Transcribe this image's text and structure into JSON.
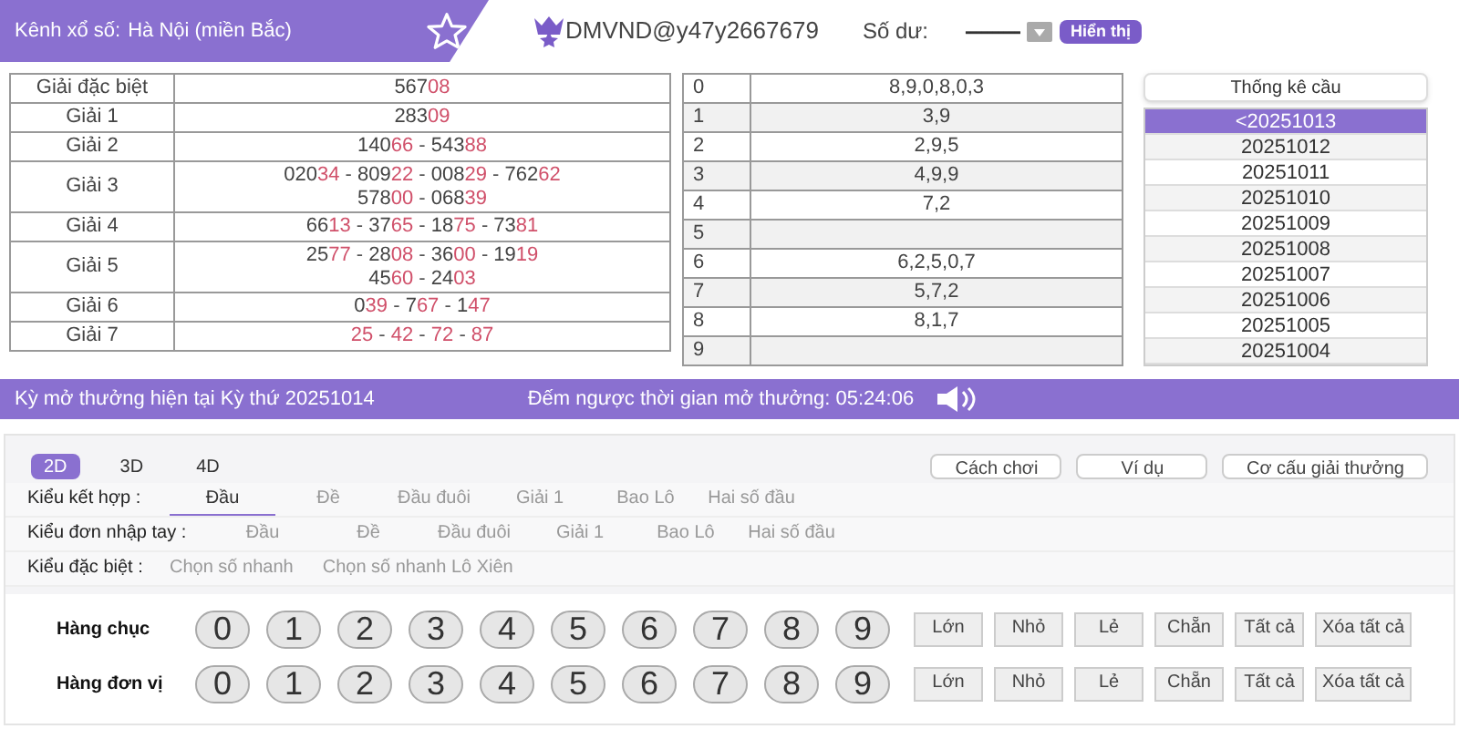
{
  "header": {
    "channel_label": "Kênh xổ số:",
    "channel": "Hà Nội (miền Bắc)",
    "username": "DMVND@y47y2667679",
    "balance_label": "Số dư:",
    "balance": "----------",
    "show_button": "Hiển thị"
  },
  "prizes": {
    "separator": " - ",
    "rows": [
      {
        "name": "Giải đặc biệt",
        "lines": [
          [
            {
              "head": "567",
              "tail": "08"
            }
          ]
        ]
      },
      {
        "name": "Giải 1",
        "lines": [
          [
            {
              "head": "283",
              "tail": "09"
            }
          ]
        ]
      },
      {
        "name": "Giải 2",
        "lines": [
          [
            {
              "head": "140",
              "tail": "66"
            },
            {
              "head": "543",
              "tail": "88"
            }
          ]
        ]
      },
      {
        "name": "Giải 3",
        "lines": [
          [
            {
              "head": "020",
              "tail": "34"
            },
            {
              "head": "809",
              "tail": "22"
            },
            {
              "head": "008",
              "tail": "29"
            },
            {
              "head": "762",
              "tail": "62"
            }
          ],
          [
            {
              "head": "578",
              "tail": "00"
            },
            {
              "head": "068",
              "tail": "39"
            }
          ]
        ]
      },
      {
        "name": "Giải 4",
        "lines": [
          [
            {
              "head": "66",
              "tail": "13"
            },
            {
              "head": "37",
              "tail": "65"
            },
            {
              "head": "18",
              "tail": "75"
            },
            {
              "head": "73",
              "tail": "81"
            }
          ]
        ]
      },
      {
        "name": "Giải 5",
        "lines": [
          [
            {
              "head": "25",
              "tail": "77"
            },
            {
              "head": "28",
              "tail": "08"
            },
            {
              "head": "36",
              "tail": "00"
            },
            {
              "head": "19",
              "tail": "19"
            }
          ],
          [
            {
              "head": "45",
              "tail": "60"
            },
            {
              "head": "24",
              "tail": "03"
            }
          ]
        ]
      },
      {
        "name": "Giải 6",
        "lines": [
          [
            {
              "head": "0",
              "tail": "39"
            },
            {
              "head": "7",
              "tail": "67"
            },
            {
              "head": "1",
              "tail": "47"
            }
          ]
        ]
      },
      {
        "name": "Giải 7",
        "lines": [
          [
            {
              "tail": "25"
            },
            {
              "tail": "42"
            },
            {
              "tail": "72"
            },
            {
              "tail": "87"
            }
          ]
        ]
      }
    ]
  },
  "head_tail": [
    {
      "digit": "0",
      "values": "8,9,0,8,0,3"
    },
    {
      "digit": "1",
      "values": "3,9"
    },
    {
      "digit": "2",
      "values": "2,9,5"
    },
    {
      "digit": "3",
      "values": "4,9,9"
    },
    {
      "digit": "4",
      "values": "7,2"
    },
    {
      "digit": "5"
    },
    {
      "digit": "6",
      "values": "6,2,5,0,7"
    },
    {
      "digit": "7",
      "values": "5,7,2"
    },
    {
      "digit": "8",
      "values": "8,1,7"
    },
    {
      "digit": "9"
    }
  ],
  "stats": {
    "button": "Thống kê cầu",
    "dates": [
      {
        "label": "<20251013",
        "selected": true
      },
      {
        "label": "20251012",
        "selected": false
      },
      {
        "label": "20251011",
        "selected": false
      },
      {
        "label": "20251010",
        "selected": false
      },
      {
        "label": "20251009",
        "selected": false
      },
      {
        "label": "20251008",
        "selected": false
      },
      {
        "label": "20251007",
        "selected": false
      },
      {
        "label": "20251006",
        "selected": false
      },
      {
        "label": "20251005",
        "selected": false
      },
      {
        "label": "20251004",
        "selected": false
      }
    ]
  },
  "draw_bar": {
    "current": "Kỳ mở thưởng hiện tại Kỳ thứ 20251014",
    "countdown": "Đếm ngược thời gian mở thưởng: 05:24:06"
  },
  "game_tabs": [
    {
      "label": "2D",
      "selected": true
    },
    {
      "label": "3D",
      "selected": false
    },
    {
      "label": "4D",
      "selected": false
    }
  ],
  "help_buttons": [
    "Cách chơi",
    "Ví dụ",
    "Cơ cấu giải thưởng"
  ],
  "bet_types": [
    {
      "label": "Kiểu kết hợp :",
      "options": [
        {
          "label": "Đầu",
          "selected": true
        },
        {
          "label": "Đề",
          "selected": false
        },
        {
          "label": "Đầu đuôi",
          "selected": false
        },
        {
          "label": "Giải 1",
          "selected": false
        },
        {
          "label": "Bao Lô",
          "selected": false
        },
        {
          "label": "Hai số đầu",
          "selected": false
        }
      ]
    },
    {
      "label": "Kiểu đơn nhập tay :",
      "options": [
        {
          "label": "Đầu",
          "selected": false
        },
        {
          "label": "Đề",
          "selected": false
        },
        {
          "label": "Đầu đuôi",
          "selected": false
        },
        {
          "label": "Giải 1",
          "selected": false
        },
        {
          "label": "Bao Lô",
          "selected": false
        },
        {
          "label": "Hai số đầu",
          "selected": false
        }
      ]
    },
    {
      "label": "Kiểu đặc biệt :",
      "options": [
        {
          "label": "Chọn số nhanh",
          "selected": false
        },
        {
          "label": "Chọn số nhanh Lô Xiên",
          "selected": false
        }
      ]
    }
  ],
  "digit_rows": [
    {
      "label": "Hàng chục",
      "digits": [
        "0",
        "1",
        "2",
        "3",
        "4",
        "5",
        "6",
        "7",
        "8",
        "9"
      ],
      "filters": [
        "Lớn",
        "Nhỏ",
        "Lẻ",
        "Chẵn",
        "Tất cả",
        "Xóa tất cả"
      ]
    },
    {
      "label": "Hàng đơn vị",
      "digits": [
        "0",
        "1",
        "2",
        "3",
        "4",
        "5",
        "6",
        "7",
        "8",
        "9"
      ],
      "filters": [
        "Lớn",
        "Nhỏ",
        "Lẻ",
        "Chẵn",
        "Tất cả",
        "Xóa tất cả"
      ]
    }
  ]
}
